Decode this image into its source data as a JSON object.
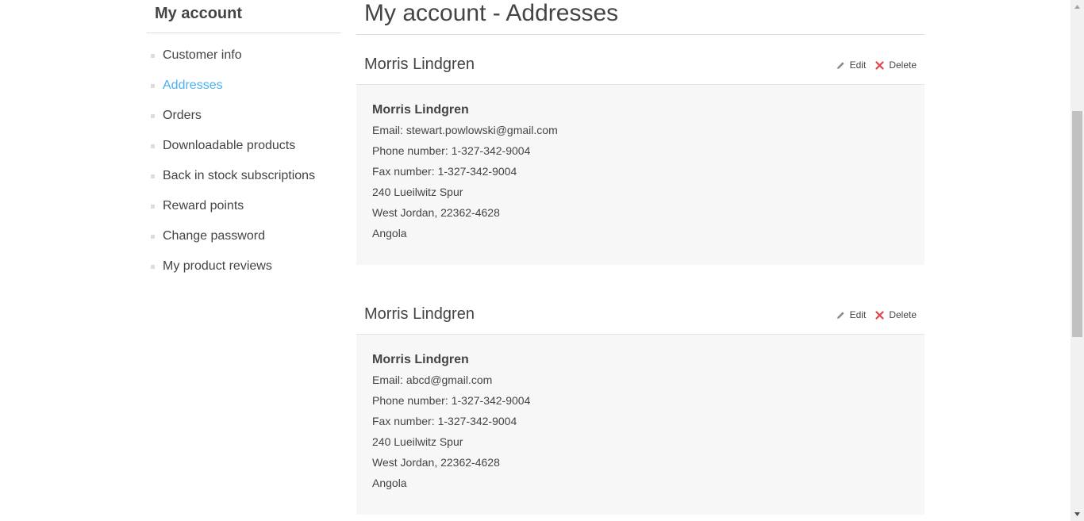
{
  "sidebar": {
    "title": "My account",
    "items": [
      {
        "label": "Customer info"
      },
      {
        "label": "Addresses"
      },
      {
        "label": "Orders"
      },
      {
        "label": "Downloadable products"
      },
      {
        "label": "Back in stock subscriptions"
      },
      {
        "label": "Reward points"
      },
      {
        "label": "Change password"
      },
      {
        "label": "My product reviews"
      }
    ],
    "active_index": 1
  },
  "main": {
    "title": "My account - Addresses",
    "actions": {
      "edit_label": "Edit",
      "delete_label": "Delete"
    },
    "addresses": [
      {
        "title": "Morris Lindgren",
        "name": "Morris Lindgren",
        "email_label": "Email:",
        "email": "stewart.powlowski@gmail.com",
        "phone_label": "Phone number:",
        "phone": "1-327-342-9004",
        "fax_label": "Fax number:",
        "fax": "1-327-342-9004",
        "address1": "240 Lueilwitz Spur",
        "city_zip": "West Jordan, 22362-4628",
        "country": "Angola"
      },
      {
        "title": "Morris Lindgren",
        "name": "Morris Lindgren",
        "email_label": "Email:",
        "email": "abcd@gmail.com",
        "phone_label": "Phone number:",
        "phone": "1-327-342-9004",
        "fax_label": "Fax number:",
        "fax": "1-327-342-9004",
        "address1": "240 Lueilwitz Spur",
        "city_zip": "West Jordan, 22362-4628",
        "country": "Angola"
      }
    ]
  },
  "colors": {
    "accent": "#4ab2f1",
    "text": "#444444",
    "delete_icon": "#e4434b",
    "panel_bg": "#f7f7f7"
  },
  "icons": {
    "edit": "pencil-icon",
    "delete": "close-icon"
  }
}
